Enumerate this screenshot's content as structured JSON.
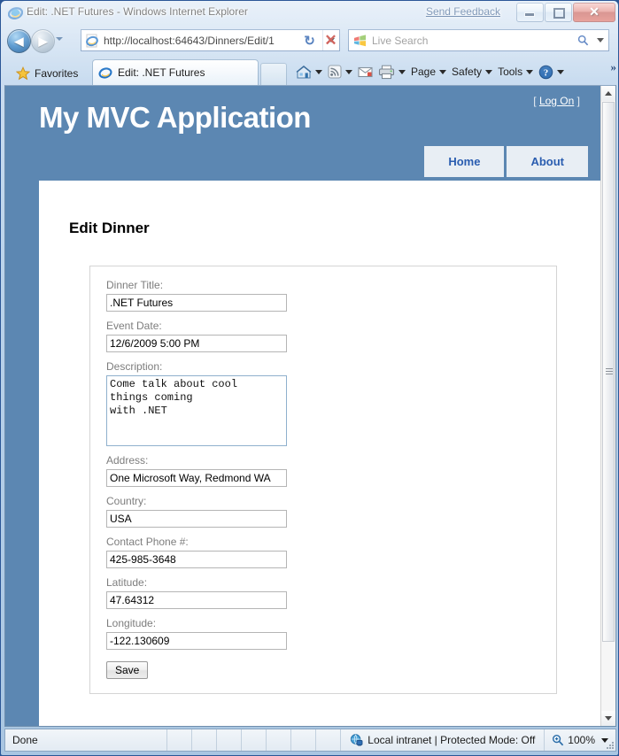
{
  "window": {
    "title": "Edit: .NET Futures - Windows Internet Explorer",
    "send_feedback": "Send Feedback",
    "minimize_label": "Minimize",
    "restore_label": "Restore",
    "close_label": "✕"
  },
  "navbar": {
    "back_glyph": "◀",
    "forward_glyph": "▶",
    "url": "http://localhost:64643/Dinners/Edit/1",
    "refresh_glyph": "↻",
    "stop_glyph": "✕",
    "search_placeholder": "Live Search"
  },
  "tabbar": {
    "favorites_label": "Favorites",
    "active_tab_title": "Edit: .NET Futures",
    "commands": [
      {
        "name": "home",
        "label": "",
        "icon": "home-icon",
        "has_caret": true
      },
      {
        "name": "feeds",
        "label": "",
        "icon": "rss-feed-icon",
        "has_caret": true
      },
      {
        "name": "read-mail",
        "label": "",
        "icon": "mail-icon",
        "has_caret": false
      },
      {
        "name": "print",
        "label": "",
        "icon": "printer-icon",
        "has_caret": true
      },
      {
        "name": "page",
        "label": "Page",
        "icon": "",
        "has_caret": true
      },
      {
        "name": "safety",
        "label": "Safety",
        "icon": "",
        "has_caret": true
      },
      {
        "name": "tools",
        "label": "Tools",
        "icon": "",
        "has_caret": true
      },
      {
        "name": "help",
        "label": "",
        "icon": "help-icon",
        "has_caret": true
      }
    ],
    "overflow_glyph": "»"
  },
  "site": {
    "title": "My MVC Application",
    "logon_prefix": "[",
    "logon_label": "Log On",
    "logon_suffix": "]",
    "nav": [
      {
        "label": "Home"
      },
      {
        "label": "About"
      }
    ],
    "accent_blue": "#5c87b2",
    "nav_tab_bg": "#e8eef4",
    "nav_tab_color": "#2a5db0"
  },
  "main": {
    "heading": "Edit Dinner",
    "fields": [
      {
        "name": "dinner-title",
        "label": "Dinner Title:",
        "value": ".NET Futures",
        "type": "text"
      },
      {
        "name": "event-date",
        "label": "Event Date:",
        "value": "12/6/2009 5:00 PM",
        "type": "text"
      },
      {
        "name": "description",
        "label": "Description:",
        "value": "Come talk about cool\nthings coming\nwith .NET",
        "type": "textarea"
      },
      {
        "name": "address",
        "label": "Address:",
        "value": "One Microsoft Way, Redmond WA",
        "type": "text"
      },
      {
        "name": "country",
        "label": "Country:",
        "value": "USA",
        "type": "text"
      },
      {
        "name": "contact-phone",
        "label": "Contact Phone #:",
        "value": "425-985-3648",
        "type": "text"
      },
      {
        "name": "latitude",
        "label": "Latitude:",
        "value": "47.64312",
        "type": "text"
      },
      {
        "name": "longitude",
        "label": "Longitude:",
        "value": "-122.130609",
        "type": "text"
      }
    ],
    "save_label": "Save"
  },
  "statusbar": {
    "status": "Done",
    "zone": "Local intranet | Protected Mode: Off",
    "zoom": "100%"
  }
}
